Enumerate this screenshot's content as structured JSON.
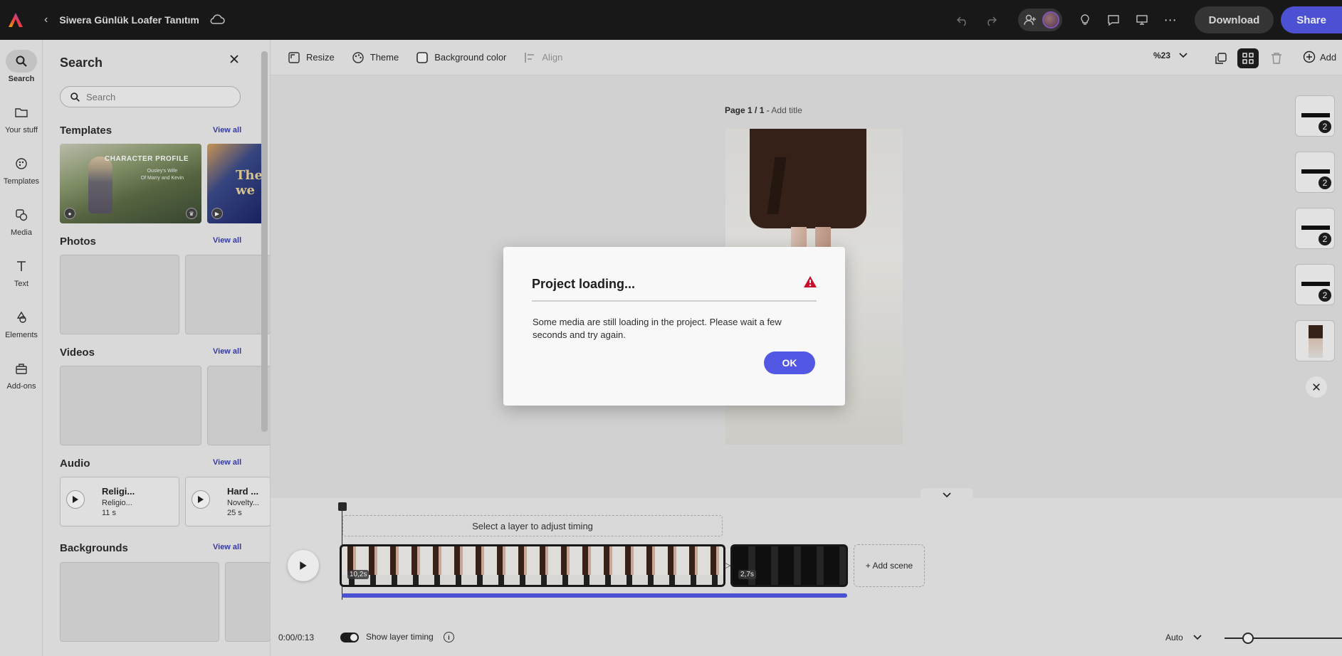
{
  "topbar": {
    "doc_title": "Siwera Günlük Loafer Tanıtım",
    "download_label": "Download",
    "share_label": "Share"
  },
  "rail": {
    "items": [
      {
        "label": "Search",
        "icon": "search-icon"
      },
      {
        "label": "Your stuff",
        "icon": "folder-icon"
      },
      {
        "label": "Templates",
        "icon": "templates-icon"
      },
      {
        "label": "Media",
        "icon": "media-icon"
      },
      {
        "label": "Text",
        "icon": "text-icon"
      },
      {
        "label": "Elements",
        "icon": "elements-icon"
      },
      {
        "label": "Add-ons",
        "icon": "addons-icon"
      }
    ]
  },
  "panel": {
    "title": "Search",
    "search_placeholder": "Search",
    "view_all": "View all",
    "sections": {
      "templates": "Templates",
      "photos": "Photos",
      "videos": "Videos",
      "audio": "Audio",
      "backgrounds": "Backgrounds"
    },
    "template_card": {
      "title": "CHARACTER PROFILE",
      "sub1": "Ousley's Wife",
      "sub2": "Of Marry and Kevin"
    },
    "template_card2": {
      "title": "The",
      "title2": "we"
    },
    "audio": [
      {
        "name": "Religi...",
        "genre": "Religio...",
        "duration": "11 s"
      },
      {
        "name": "Hard ...",
        "genre": "Novelty...",
        "duration": "25 s"
      }
    ]
  },
  "toolbar": {
    "resize": "Resize",
    "theme": "Theme",
    "background_color": "Background color",
    "align": "Align",
    "zoom": "%23",
    "add": "Add"
  },
  "canvas": {
    "page_label": "Page 1 / 1",
    "page_sep": " - ",
    "add_title": "Add title",
    "thumb_badges": [
      "2",
      "2",
      "2",
      "2"
    ]
  },
  "timeline": {
    "layer_hint": "Select a layer to adjust timing",
    "clip1_duration": "10,2s",
    "clip2_duration": "2,7s",
    "add_scene": "+ Add scene",
    "time": "0:00/0:13",
    "show_layer_timing": "Show layer timing",
    "auto": "Auto",
    "progress_fraction": 0.96,
    "zoom_slider_fraction": 0.2
  },
  "dialog": {
    "title": "Project loading...",
    "body": "Some media are still loading in the project. Please wait a few seconds and try again.",
    "ok": "OK"
  },
  "colors": {
    "accent": "#5258e4",
    "topbar_bg": "#1b1b1b",
    "alert": "#c8102e"
  }
}
